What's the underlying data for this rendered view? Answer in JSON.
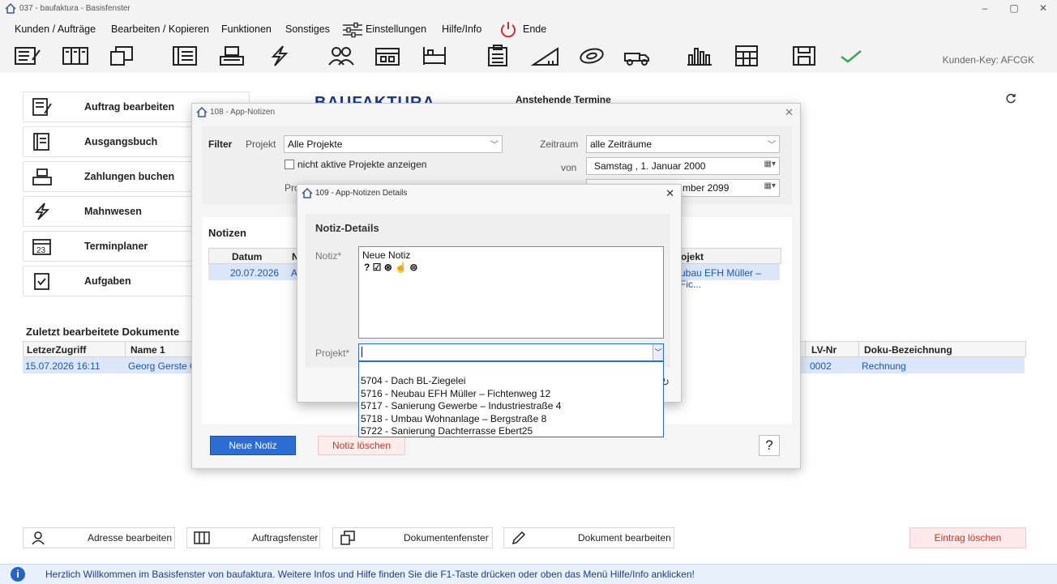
{
  "window": {
    "title": "037  -  baufaktura  -  Basisfenster",
    "minimize": "–",
    "maximize": "▢",
    "close": "✕"
  },
  "menu": {
    "items": [
      "Kunden / Aufträge",
      "Bearbeiten / Kopieren",
      "Funktionen",
      "Sonstiges",
      "Einstellungen",
      "Hilfe/Info",
      "Ende"
    ]
  },
  "toolbar": {
    "icons": [
      "document-edit-icon",
      "binder-icon",
      "copy-pages-icon",
      "book-icon",
      "cash-register-icon",
      "lightning-icon",
      "users-icon",
      "rack-icon",
      "shelf-icon",
      "clipboard-icon",
      "ruler-icon",
      "tape-icon",
      "truck-icon",
      "factory-icon",
      "calculator-icon",
      "save-icon",
      "checkmark-icon"
    ],
    "kunden_key": "Kunden-Key: AFCGK"
  },
  "sidebar": {
    "items": [
      {
        "label": "Auftrag bearbeiten",
        "icon": "document-edit-icon"
      },
      {
        "label": "Ausgangsbuch",
        "icon": "book-icon"
      },
      {
        "label": "Zahlungen buchen",
        "icon": "cash-register-icon"
      },
      {
        "label": "Mahnwesen",
        "icon": "lightning-icon"
      },
      {
        "label": "Terminplaner",
        "icon": "calendar-icon"
      },
      {
        "label": "Aufgaben",
        "icon": "clipboard-check-icon"
      }
    ]
  },
  "main": {
    "logo": "BAUFAKTURA",
    "termine_title": "Anstehende Termine",
    "docs_title": "Zuletzt bearbeitete Dokumente",
    "docs_columns": [
      "LetzerZugriff",
      "Name 1",
      "LV-Nr",
      "Doku-Bezeichnung"
    ],
    "docs_row": [
      "15.07.2026 16:11",
      "Georg Gerste G",
      "0002",
      "Rechnung"
    ]
  },
  "bottom_buttons": {
    "adresse": "Adresse bearbeiten",
    "auftrag": "Auftragsfenster",
    "dokumente": "Dokumentenfenster",
    "dokument_bearbeiten": "Dokument bearbeiten",
    "eintrag_loeschen": "Eintrag löschen"
  },
  "statusbar": {
    "info": "i",
    "text": "Herzlich Willkommen im Basisfenster von baufaktura. Weitere Infos und Hilfe finden Sie die F1-Taste drücken oder oben das Menü Hilfe/Info anklicken!"
  },
  "dlg108": {
    "title": "108  -  App-Notizen",
    "filter_label": "Filter",
    "projekt_label": "Projekt",
    "projekt_value": "Alle Projekte",
    "checkbox_label": "nicht aktive Projekte anzeigen",
    "pr_label": "Pro",
    "zeitraum_label": "Zeitraum",
    "zeitraum_value": "alle Zeiträume",
    "von_label": "von",
    "von_value": "Samstag  ,   1.    Januar     2000",
    "bis_value": "mber 2099",
    "notizen_title": "Notizen",
    "col_datum": "Datum",
    "col_n": "N",
    "col_projekt": "ojekt",
    "row_datum": "20.07.2026",
    "row_n": "A",
    "row_projekt": "ubau EFH Müller – Fic...",
    "neue_notiz": "Neue Notiz",
    "notiz_loeschen": "Notiz löschen",
    "help": "?"
  },
  "dlg109": {
    "title": "109  -  App-Notizen Details",
    "section_title": "Notiz-Details",
    "notiz_label": "Notiz*",
    "notiz_text": "Neue Notiz",
    "notiz_symbols": "? ☑ ⊛ ☝ ⊜",
    "projekt_label": "Projekt*",
    "projekt_value": "",
    "options": [
      "5704 - Dach BL-Ziegelei",
      "5716 - Neubau EFH Müller – Fichtenweg 12",
      "5717 - Sanierung Gewerbe – Industriestraße 4",
      "5718 - Umbau Wohnanlage – Bergstraße 8",
      "5722 - Sanierung Dachterrasse Ebert25"
    ]
  }
}
